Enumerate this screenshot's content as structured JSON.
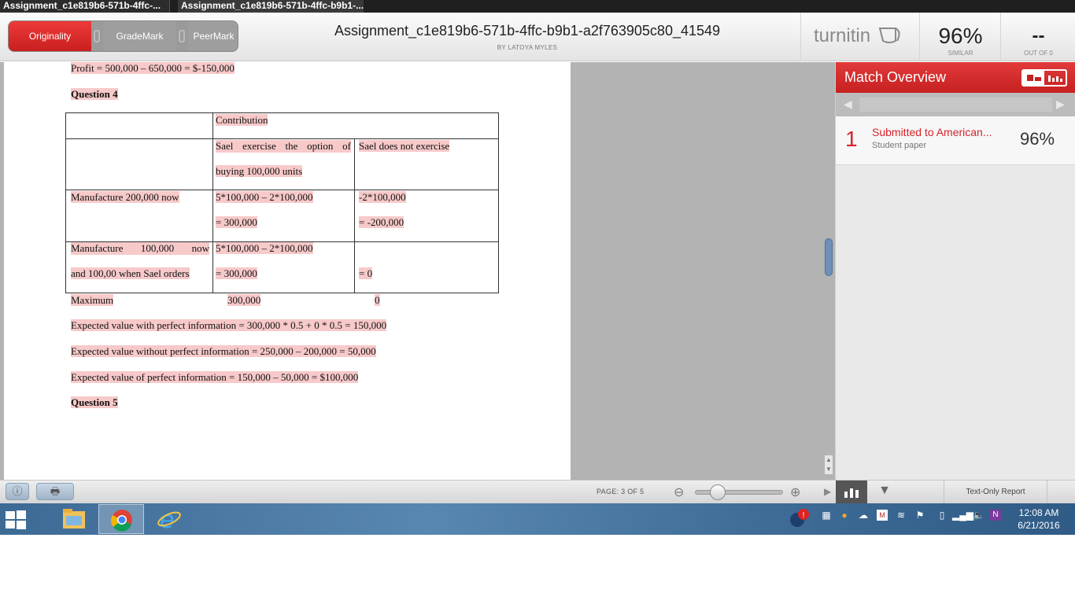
{
  "browser": {
    "tabs": [
      {
        "label": "Assignment_c1e819b6-571b-4ffc-..."
      },
      {
        "label": "Assignment_c1e819b6-571b-4ffc-b9b1-..."
      }
    ]
  },
  "header": {
    "modes": {
      "originality": "Originality",
      "grademark": "GradeMark",
      "peermark": "PeerMark"
    },
    "title": "Assignment_c1e819b6-571b-4ffc-b9b1-a2f763905c80_41549",
    "author": "BY LATOYA MYLES",
    "brand": "turnitin",
    "similarity_score": "96%",
    "similarity_label": "SIMILAR",
    "out_of": "--",
    "out_of_label": "OUT OF 0"
  },
  "document": {
    "profit_line": "Profit = 500,000 – 650,000 = $-150,000",
    "question4": "Question 4",
    "table": {
      "header": "Contribution",
      "col1": [
        "Sael",
        "exercise",
        "the",
        "option",
        "of"
      ],
      "col1b": "buying 100,000 units",
      "col2": "Sael does not exercise",
      "row1_label": "Manufacture 200,000 now",
      "row1_c1a": "5*100,000 – 2*100,000",
      "row1_c1b": "= 300,000",
      "row1_c2a": "-2*100,000",
      "row1_c2b": "= -200,000",
      "row2_label_a": [
        "Manufacture",
        "100,000",
        "now"
      ],
      "row2_label_b": "and 100,00 when Sael orders",
      "row2_c1a": "5*100,000 – 2*100,000",
      "row2_c1b": "= 300,000",
      "row2_c2b": "= 0"
    },
    "maximum_label": "Maximum",
    "maximum_c1": "300,000",
    "maximum_c2": "0",
    "ev_perfect": "Expected value with perfect information = 300,000 * 0.5 + 0 * 0.5 = 150,000",
    "ev_without": "Expected value without perfect information = 250,000 – 200,000 = 50,000",
    "ev_of": "Expected value of perfect information = 150,000 – 50,000 = $100,000",
    "question5": "Question 5"
  },
  "panel": {
    "title": "Match Overview",
    "matches": [
      {
        "number": "1",
        "source": "Submitted to American...",
        "type": "Student paper",
        "percent": "96%"
      }
    ],
    "accent": "#d7232a"
  },
  "toolbar": {
    "page_indicator": "PAGE:  3 OF 5",
    "text_only": "Text-Only Report"
  },
  "taskbar": {
    "time": "12:08 AM",
    "date": "6/21/2016",
    "apps": [
      "file-explorer",
      "chrome",
      "internet-explorer"
    ]
  }
}
